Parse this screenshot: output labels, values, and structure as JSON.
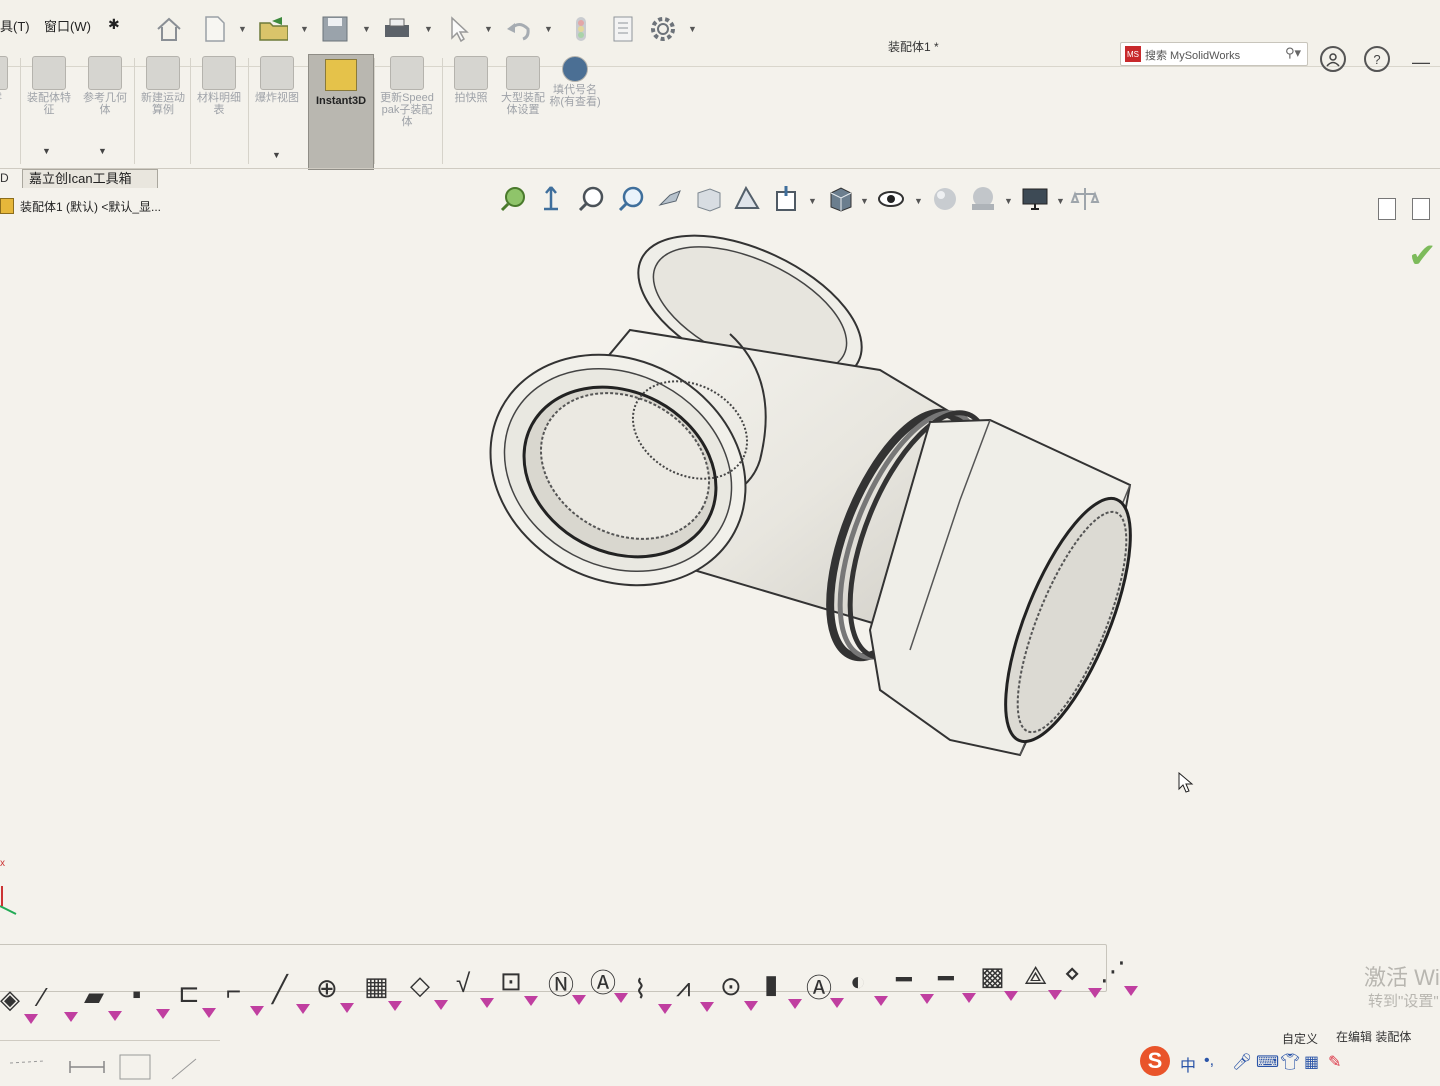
{
  "menu": {
    "tools_partial": "具(T)",
    "window": "窗口(W)",
    "pin": "✱"
  },
  "quick_access": {
    "icons": [
      "home-icon",
      "new-document-icon",
      "open-folder-icon",
      "save-icon",
      "print-icon",
      "select-arrow-icon",
      "undo-icon",
      "traffic-light-icon",
      "file-properties-icon",
      "options-gear-icon"
    ]
  },
  "title": {
    "document": "装配体1 *"
  },
  "search": {
    "placeholder": "搜索 MySolidWorks",
    "logo": "MS",
    "icon": "search-magnifier-icon"
  },
  "ribbon": {
    "partial_left": "隐零",
    "buttons": [
      {
        "label": "装配体特征"
      },
      {
        "label": "参考几何体"
      },
      {
        "label": "新建运动算例"
      },
      {
        "label": "材料明细表"
      },
      {
        "label": "爆炸视图"
      },
      {
        "label": "Instant3D"
      },
      {
        "label": "更新Speedpak子装配体"
      },
      {
        "label": "拍快照"
      },
      {
        "label": "大型装配体设置"
      },
      {
        "label": "填代号名称(有查看)"
      }
    ]
  },
  "tabs": {
    "left_partial": "D",
    "active": "嘉立创Ican工具箱"
  },
  "tree": {
    "root": "装配体1 (默认) <默认_显..."
  },
  "heads_up_icons": [
    "zoom-to-fit-icon",
    "zoom-area-icon",
    "previous-view-icon",
    "section-view-icon",
    "dynamic-annotation-icon",
    "view-orientation-icon",
    "display-style-icon",
    "hide-show-icon",
    "edit-appearance-icon",
    "apply-scene-icon",
    "view-settings-icon",
    "render-tools-icon"
  ],
  "watermark": {
    "line1": "激活 Wi",
    "line2": "转到\"设置\""
  },
  "status": {
    "custom": "自定义",
    "editing": "在编辑 装配体"
  },
  "ime": {
    "logo": "S",
    "mode": "中",
    "punct": "•,"
  }
}
